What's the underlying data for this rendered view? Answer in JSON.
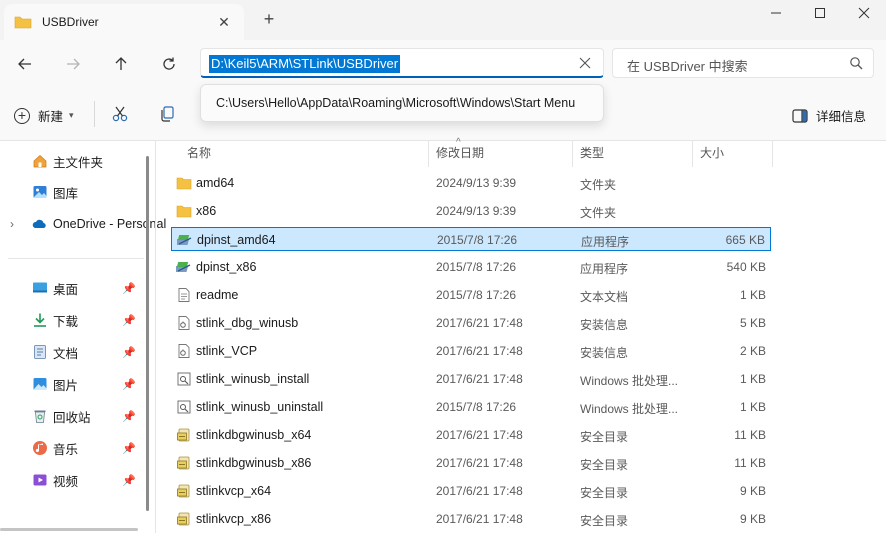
{
  "window": {
    "tab_title": "USBDriver",
    "minimize": "—",
    "maximize": "☐",
    "close": "✕",
    "new_tab": "+"
  },
  "nav": {
    "address": "D:\\Keil5\\ARM\\STLink\\USBDriver",
    "search_placeholder": "在 USBDriver 中搜索",
    "suggestion": "C:\\Users\\Hello\\AppData\\Roaming\\Microsoft\\Windows\\Start Menu"
  },
  "toolbar": {
    "new_label": "新建",
    "details_label": "详细信息"
  },
  "sidebar": {
    "items": [
      {
        "label": "主文件夹",
        "icon": "home-icon"
      },
      {
        "label": "图库",
        "icon": "gallery-icon"
      },
      {
        "label": "OneDrive - Personal",
        "icon": "onedrive-icon"
      },
      {
        "label": "桌面",
        "icon": "desktop-icon",
        "pinned": true
      },
      {
        "label": "下载",
        "icon": "download-icon",
        "pinned": true
      },
      {
        "label": "文档",
        "icon": "documents-icon",
        "pinned": true
      },
      {
        "label": "图片",
        "icon": "pictures-icon",
        "pinned": true
      },
      {
        "label": "回收站",
        "icon": "recycle-bin-icon",
        "pinned": true
      },
      {
        "label": "音乐",
        "icon": "music-icon",
        "pinned": true
      },
      {
        "label": "视频",
        "icon": "videos-icon",
        "pinned": true
      }
    ]
  },
  "columns": {
    "name": "名称",
    "date": "修改日期",
    "type": "类型",
    "size": "大小"
  },
  "files": [
    {
      "name": "amd64",
      "date": "2024/9/13 9:39",
      "type": "文件夹",
      "size": "",
      "icon": "folder-icon"
    },
    {
      "name": "x86",
      "date": "2024/9/13 9:39",
      "type": "文件夹",
      "size": "",
      "icon": "folder-icon"
    },
    {
      "name": "dpinst_amd64",
      "date": "2015/7/8 17:26",
      "type": "应用程序",
      "size": "665 KB",
      "icon": "installer-icon",
      "selected": true
    },
    {
      "name": "dpinst_x86",
      "date": "2015/7/8 17:26",
      "type": "应用程序",
      "size": "540 KB",
      "icon": "installer-icon"
    },
    {
      "name": "readme",
      "date": "2015/7/8 17:26",
      "type": "文本文档",
      "size": "1 KB",
      "icon": "text-file-icon"
    },
    {
      "name": "stlink_dbg_winusb",
      "date": "2017/6/21 17:48",
      "type": "安装信息",
      "size": "5 KB",
      "icon": "setup-info-icon"
    },
    {
      "name": "stlink_VCP",
      "date": "2017/6/21 17:48",
      "type": "安装信息",
      "size": "2 KB",
      "icon": "setup-info-icon"
    },
    {
      "name": "stlink_winusb_install",
      "date": "2017/6/21 17:48",
      "type": "Windows 批处理...",
      "size": "1 KB",
      "icon": "batch-file-icon"
    },
    {
      "name": "stlink_winusb_uninstall",
      "date": "2015/7/8 17:26",
      "type": "Windows 批处理...",
      "size": "1 KB",
      "icon": "batch-file-icon"
    },
    {
      "name": "stlinkdbgwinusb_x64",
      "date": "2017/6/21 17:48",
      "type": "安全目录",
      "size": "11 KB",
      "icon": "security-catalog-icon"
    },
    {
      "name": "stlinkdbgwinusb_x86",
      "date": "2017/6/21 17:48",
      "type": "安全目录",
      "size": "11 KB",
      "icon": "security-catalog-icon"
    },
    {
      "name": "stlinkvcp_x64",
      "date": "2017/6/21 17:48",
      "type": "安全目录",
      "size": "9 KB",
      "icon": "security-catalog-icon"
    },
    {
      "name": "stlinkvcp_x86",
      "date": "2017/6/21 17:48",
      "type": "安全目录",
      "size": "9 KB",
      "icon": "security-catalog-icon"
    }
  ],
  "colors": {
    "accent": "#0078d4",
    "selection": "#cce8ff",
    "folder": "#f5c142"
  }
}
